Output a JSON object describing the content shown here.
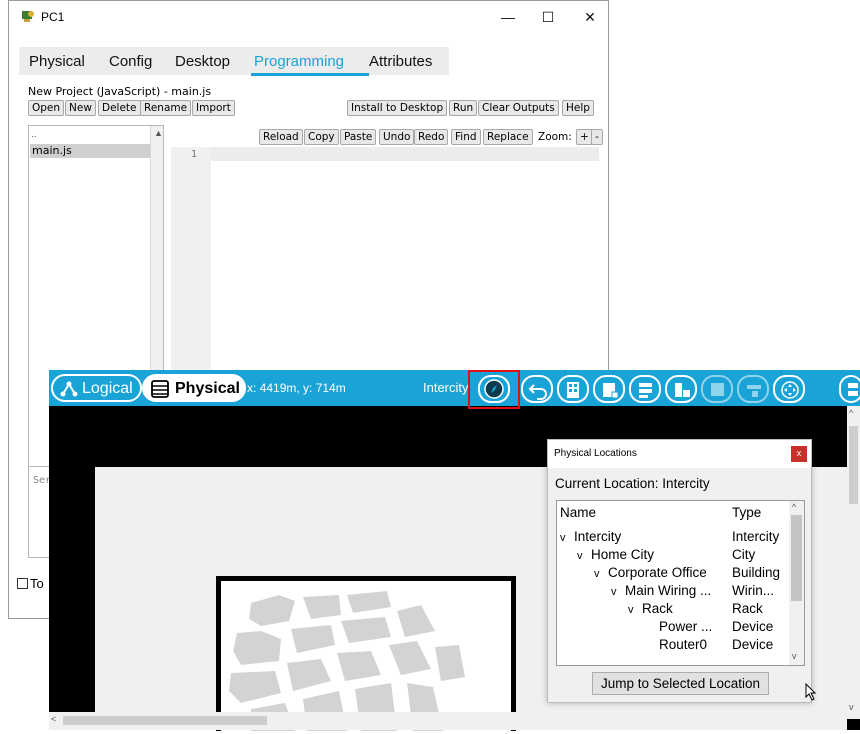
{
  "pc_window": {
    "title": "PC1",
    "controls": {
      "minimize": "—",
      "maximize": "☐",
      "close": "✕"
    },
    "tabs": [
      {
        "label": "Physical"
      },
      {
        "label": "Config"
      },
      {
        "label": "Desktop"
      },
      {
        "label": "Programming",
        "active": true
      },
      {
        "label": "Attributes"
      }
    ],
    "project_title": "New Project (JavaScript) - main.js",
    "project_buttons": [
      "Open",
      "New",
      "Delete",
      "Rename",
      "Import"
    ],
    "right_buttons": [
      "Install to Desktop",
      "Run",
      "Clear Outputs",
      "Help"
    ],
    "file_tree": {
      "up": "..",
      "selected_file": "main.js"
    },
    "editor_toolbar": {
      "buttons": [
        "Reload",
        "Copy",
        "Paste",
        "Undo",
        "Redo",
        "Find",
        "Replace"
      ],
      "zoom_label": "Zoom:",
      "zoom_in": "+",
      "zoom_out": "-"
    },
    "line_number": "1",
    "console_placeholder": "Ser",
    "bottom_checkbox": "To"
  },
  "workspace": {
    "logical_label": "Logical",
    "physical_label": "Physical",
    "coordinates": "x: 4419m, y: 714m",
    "current_location": "Intercity",
    "toolbar_icons": [
      "compass-icon",
      "back-arrow-icon",
      "new-building-icon",
      "new-closet-icon",
      "new-rack-icon",
      "new-table-icon",
      "new-wiring-closet-icon",
      "new-room-icon",
      "move-icon",
      "more-icon"
    ],
    "accent": "#1aa3d6"
  },
  "dialog": {
    "title": "Physical Locations",
    "close": "x",
    "current_location": "Current Location: Intercity",
    "columns": {
      "name": "Name",
      "type": "Type"
    },
    "rows": [
      {
        "name": "Intercity",
        "type": "Intercity",
        "level": 0,
        "expanded": true
      },
      {
        "name": "Home City",
        "type": "City",
        "level": 1,
        "expanded": true
      },
      {
        "name": "Corporate Office",
        "type": "Building",
        "level": 2,
        "expanded": true
      },
      {
        "name": "Main Wiring ...",
        "type": "Wirin...",
        "level": 3,
        "expanded": true
      },
      {
        "name": "Rack",
        "type": "Rack",
        "level": 4,
        "expanded": true
      },
      {
        "name": "Power ...",
        "type": "Device",
        "level": 5,
        "expanded": false
      },
      {
        "name": "Router0",
        "type": "Device",
        "level": 5,
        "expanded": false
      }
    ],
    "jump_button": "Jump to Selected Location"
  }
}
